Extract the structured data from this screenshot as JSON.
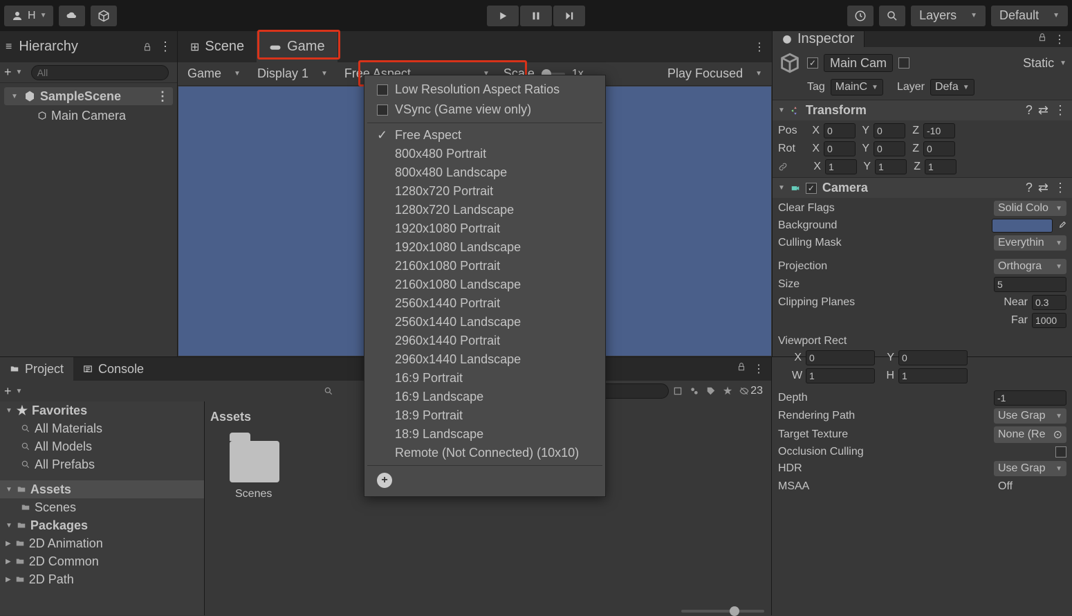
{
  "toolbar": {
    "account_initial": "H",
    "layers_label": "Layers",
    "layout_label": "Default"
  },
  "hierarchy": {
    "title": "Hierarchy",
    "search_placeholder": "All",
    "scene": "SampleScene",
    "children": [
      "Main Camera"
    ]
  },
  "center": {
    "scene_tab": "Scene",
    "game_tab": "Game",
    "game_dd": "Game",
    "display_dd": "Display 1",
    "aspect_dd": "Free Aspect",
    "scale_label": "Scale",
    "scale_value": "1x",
    "play_focused": "Play Focused"
  },
  "aspect_menu": {
    "low_res": "Low Resolution Aspect Ratios",
    "vsync": "VSync (Game view only)",
    "items": [
      "Free Aspect",
      "800x480 Portrait",
      "800x480 Landscape",
      "1280x720 Portrait",
      "1280x720 Landscape",
      "1920x1080 Portrait",
      "1920x1080 Landscape",
      "2160x1080 Portrait",
      "2160x1080 Landscape",
      "2560x1440 Portrait",
      "2560x1440 Landscape",
      "2960x1440 Portrait",
      "2960x1440 Landscape",
      "16:9 Portrait",
      "16:9 Landscape",
      "18:9 Portrait",
      "18:9 Landscape",
      "Remote (Not Connected) (10x10)"
    ],
    "selected_index": 0
  },
  "inspector": {
    "title": "Inspector",
    "name": "Main Came",
    "static_label": "Static",
    "tag_label": "Tag",
    "tag_value": "MainC",
    "layer_label": "Layer",
    "layer_value": "Defa",
    "transform": {
      "title": "Transform",
      "pos_label": "Pos",
      "rot_label": "Rot",
      "x": "0",
      "y": "0",
      "z": "-10",
      "rx": "0",
      "ry": "0",
      "rz": "0",
      "sx": "1",
      "sy": "1",
      "sz": "1"
    },
    "camera": {
      "title": "Camera",
      "clear_flags_label": "Clear Flags",
      "clear_flags_value": "Solid Colo",
      "background_label": "Background",
      "culling_mask_label": "Culling Mask",
      "culling_mask_value": "Everythin",
      "projection_label": "Projection",
      "projection_value": "Orthogra",
      "size_label": "Size",
      "size_value": "5",
      "clipping_label": "Clipping Planes",
      "near_label": "Near",
      "near_value": "0.3",
      "far_label": "Far",
      "far_value": "1000",
      "viewport_label": "Viewport Rect",
      "vx": "0",
      "vy": "0",
      "vw": "1",
      "vh": "1",
      "depth_label": "Depth",
      "depth_value": "-1",
      "rendering_path_label": "Rendering Path",
      "rendering_path_value": "Use Grap",
      "target_texture_label": "Target Texture",
      "target_texture_value": "None (Re",
      "occlusion_label": "Occlusion Culling",
      "hdr_label": "HDR",
      "hdr_value": "Use Grap",
      "msaa_label": "MSAA",
      "msaa_value": "Off"
    }
  },
  "project": {
    "project_tab": "Project",
    "console_tab": "Console",
    "favorites_label": "Favorites",
    "fav_items": [
      "All Materials",
      "All Models",
      "All Prefabs"
    ],
    "assets_label": "Assets",
    "assets_children": [
      "Scenes"
    ],
    "packages_label": "Packages",
    "packages_children": [
      "2D Animation",
      "2D Common",
      "2D Path"
    ],
    "breadcrumb": "Assets",
    "folder_name": "Scenes",
    "hidden_count": "23"
  }
}
